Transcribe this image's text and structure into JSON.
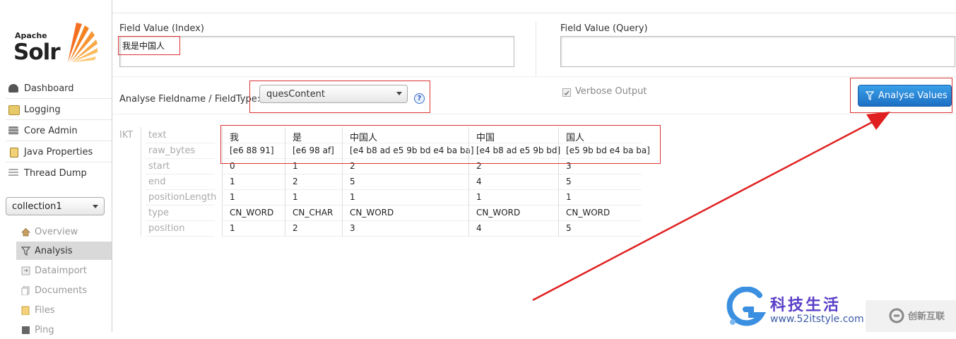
{
  "sidebar": {
    "logo_top": "Apache",
    "logo_main": "Solr",
    "nav": [
      {
        "label": "Dashboard",
        "icon": "dashboard-icon"
      },
      {
        "label": "Logging",
        "icon": "logging-icon"
      },
      {
        "label": "Core Admin",
        "icon": "core-admin-icon"
      },
      {
        "label": "Java Properties",
        "icon": "java-properties-icon"
      },
      {
        "label": "Thread Dump",
        "icon": "thread-dump-icon"
      }
    ],
    "core_selected": "collection1",
    "core_menu": [
      {
        "label": "Overview",
        "icon": "home-icon"
      },
      {
        "label": "Analysis",
        "icon": "filter-icon"
      },
      {
        "label": "Dataimport",
        "icon": "dataimport-icon"
      },
      {
        "label": "Documents",
        "icon": "documents-icon"
      },
      {
        "label": "Files",
        "icon": "folder-icon"
      },
      {
        "label": "Ping",
        "icon": "ping-icon"
      }
    ]
  },
  "analysis": {
    "index_label": "Field Value (Index)",
    "index_value": "我是中国人",
    "query_label": "Field Value (Query)",
    "query_value": "",
    "fieldtype_label": "Analyse Fieldname / FieldType:",
    "fieldtype_value": "quesContent",
    "verbose_label": "Verbose Output",
    "verbose_checked": true,
    "analyse_button": "Analyse Values"
  },
  "results": {
    "analyzer": "IKT",
    "row_labels": [
      "text",
      "raw_bytes",
      "start",
      "end",
      "positionLength",
      "type",
      "position"
    ],
    "tokens": [
      {
        "text": "我",
        "raw_bytes": "[e6 88 91]",
        "start": "0",
        "end": "1",
        "positionLength": "1",
        "type": "CN_WORD",
        "position": "1"
      },
      {
        "text": "是",
        "raw_bytes": "[e6 98 af]",
        "start": "1",
        "end": "2",
        "positionLength": "1",
        "type": "CN_CHAR",
        "position": "2"
      },
      {
        "text": "中国人",
        "raw_bytes": "[e4 b8 ad e5 9b bd e4 ba ba]",
        "start": "2",
        "end": "5",
        "positionLength": "1",
        "type": "CN_WORD",
        "position": "3"
      },
      {
        "text": "中国",
        "raw_bytes": "[e4 b8 ad e5 9b bd]",
        "start": "2",
        "end": "4",
        "positionLength": "1",
        "type": "CN_WORD",
        "position": "4"
      },
      {
        "text": "国人",
        "raw_bytes": "[e5 9b bd e4 ba ba]",
        "start": "3",
        "end": "5",
        "positionLength": "1",
        "type": "CN_WORD",
        "position": "5"
      }
    ]
  },
  "watermark": {
    "title": "科技生活",
    "url": "www.52itstyle.com",
    "brand": "创新互联"
  },
  "colors": {
    "accent_button": "#1d6fc4",
    "annotation_red": "#e02020",
    "active_menu": "#d9d9d9"
  }
}
